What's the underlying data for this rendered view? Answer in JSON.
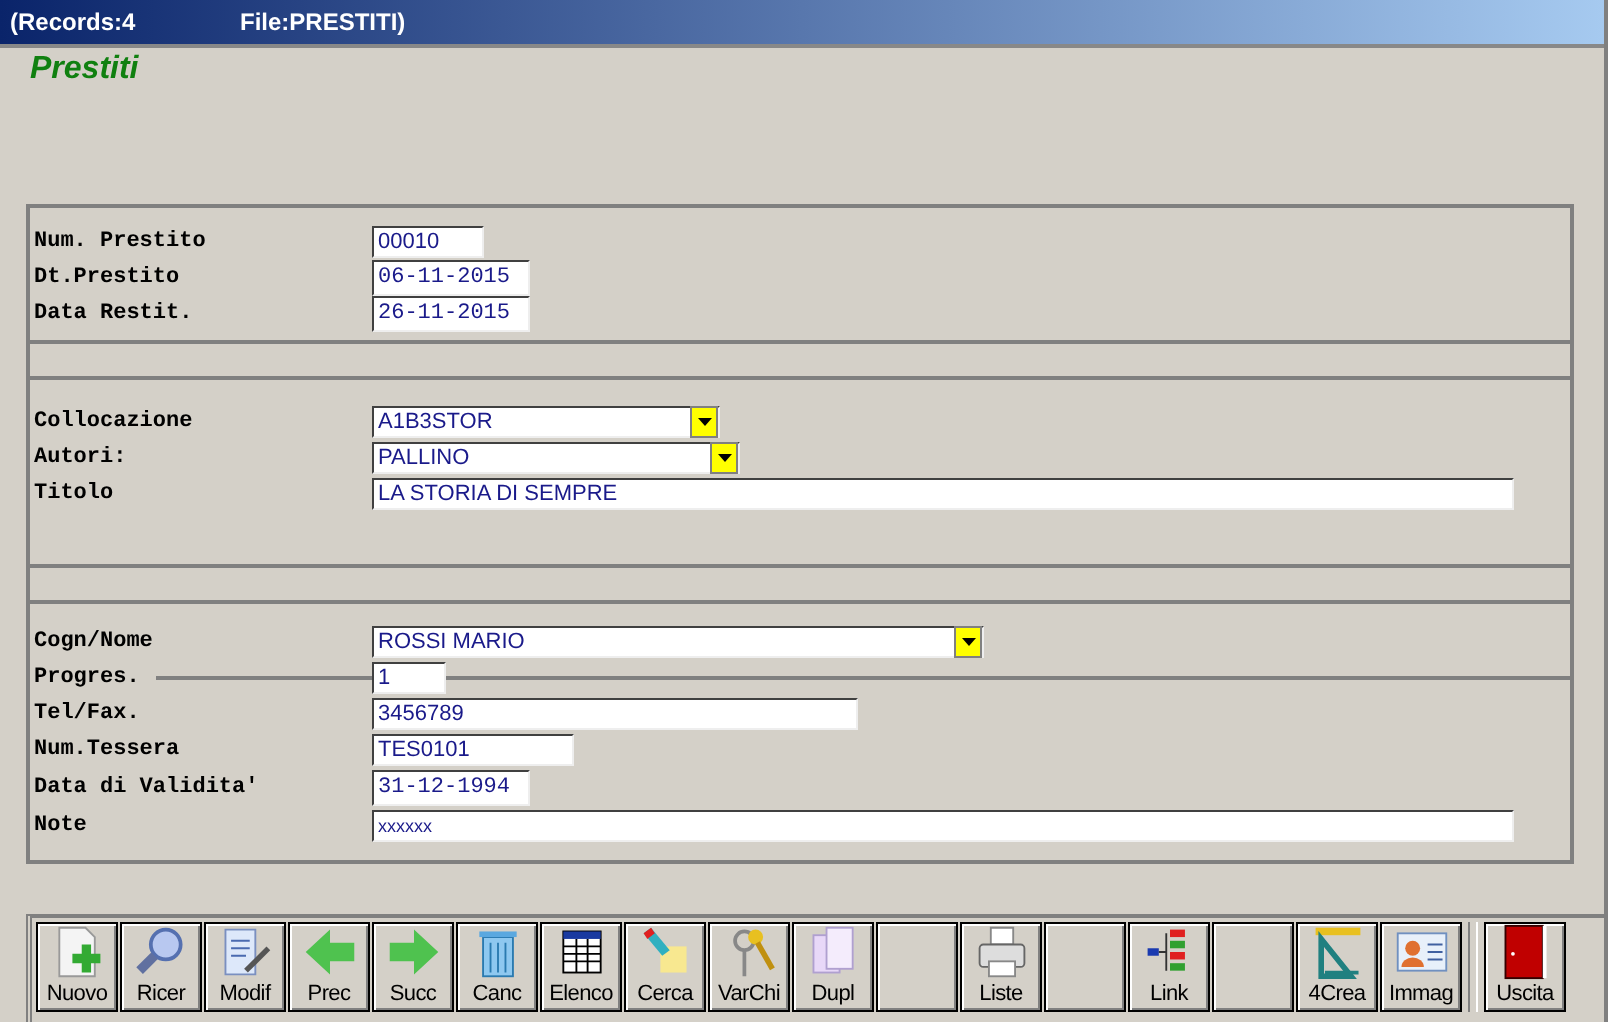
{
  "window": {
    "records": "(Records:4",
    "file": "File:PRESTITI)"
  },
  "heading": "Prestiti",
  "sections": [
    {
      "rows": [
        {
          "label": "Num. Prestito",
          "value": "00010",
          "kind": "text"
        },
        {
          "label": "Dt.Prestito",
          "value": "06-11-2015",
          "kind": "date"
        },
        {
          "label": "Data Restit.",
          "value": "26-11-2015",
          "kind": "date"
        }
      ]
    },
    {
      "rows": [
        {
          "label": "Collocazione",
          "value": "A1B3STOR",
          "kind": "dropdown"
        },
        {
          "label": "Autori:",
          "value": "PALLINO",
          "kind": "dropdown"
        },
        {
          "label": "Titolo",
          "value": "LA STORIA DI SEMPRE",
          "kind": "text"
        }
      ]
    },
    {
      "rows": [
        {
          "label": "Cogn/Nome",
          "value": "ROSSI MARIO",
          "kind": "dropdown"
        },
        {
          "label": "Progres.",
          "value": "1",
          "kind": "text"
        },
        {
          "label": "Tel/Fax.",
          "value": "3456789",
          "kind": "text"
        },
        {
          "label": "Num.Tessera",
          "value": "TES0101",
          "kind": "text"
        },
        {
          "label": "Data di Validita'",
          "value": "31-12-1994",
          "kind": "date"
        },
        {
          "label": "Note",
          "value": "xxxxxx",
          "kind": "note"
        }
      ]
    }
  ],
  "toolbar": [
    {
      "kind": "button",
      "label": "Nuovo"
    },
    {
      "kind": "button",
      "label": "Ricer"
    },
    {
      "kind": "button",
      "label": "Modif"
    },
    {
      "kind": "button",
      "label": "Prec"
    },
    {
      "kind": "button",
      "label": "Succ"
    },
    {
      "kind": "button",
      "label": "Canc"
    },
    {
      "kind": "button",
      "label": "Elenco"
    },
    {
      "kind": "button",
      "label": "Cerca"
    },
    {
      "kind": "button",
      "label": "VarChi"
    },
    {
      "kind": "button",
      "label": "Dupl"
    },
    {
      "kind": "blank"
    },
    {
      "kind": "button",
      "label": "Liste"
    },
    {
      "kind": "blank"
    },
    {
      "kind": "button",
      "label": "Link"
    },
    {
      "kind": "blank"
    },
    {
      "kind": "button",
      "label": "4Crea"
    },
    {
      "kind": "button",
      "label": "Immag"
    },
    {
      "kind": "exit",
      "label": "Uscita"
    }
  ]
}
